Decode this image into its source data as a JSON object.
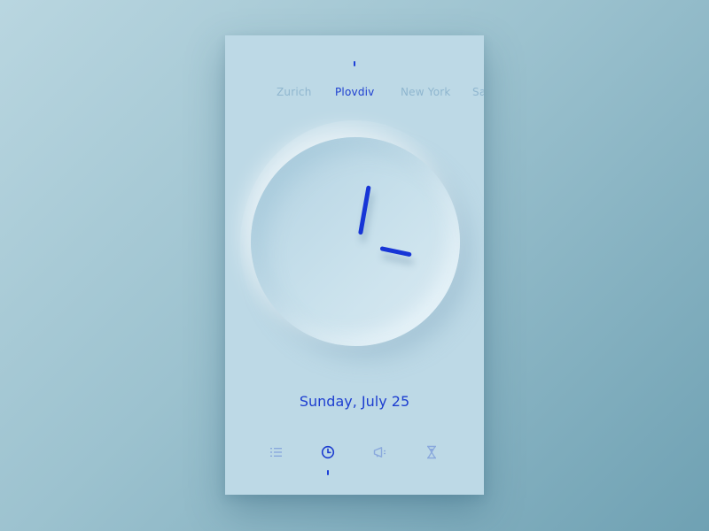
{
  "cities": [
    "Zurich",
    "Plovdiv",
    "New York",
    "Sa"
  ],
  "active_city_index": 1,
  "date": "Sunday, July 25",
  "nav": {
    "items": [
      {
        "icon": "list-icon",
        "active": false
      },
      {
        "icon": "clock-icon",
        "active": true
      },
      {
        "icon": "megaphone-icon",
        "active": false
      },
      {
        "icon": "hourglass-icon",
        "active": false
      }
    ]
  },
  "colors": {
    "accent": "#1d3ed0",
    "inactive_text": "#8fb6cf",
    "inactive_icon": "#8aa9dd",
    "phone_bg": "#bdd9e6"
  }
}
